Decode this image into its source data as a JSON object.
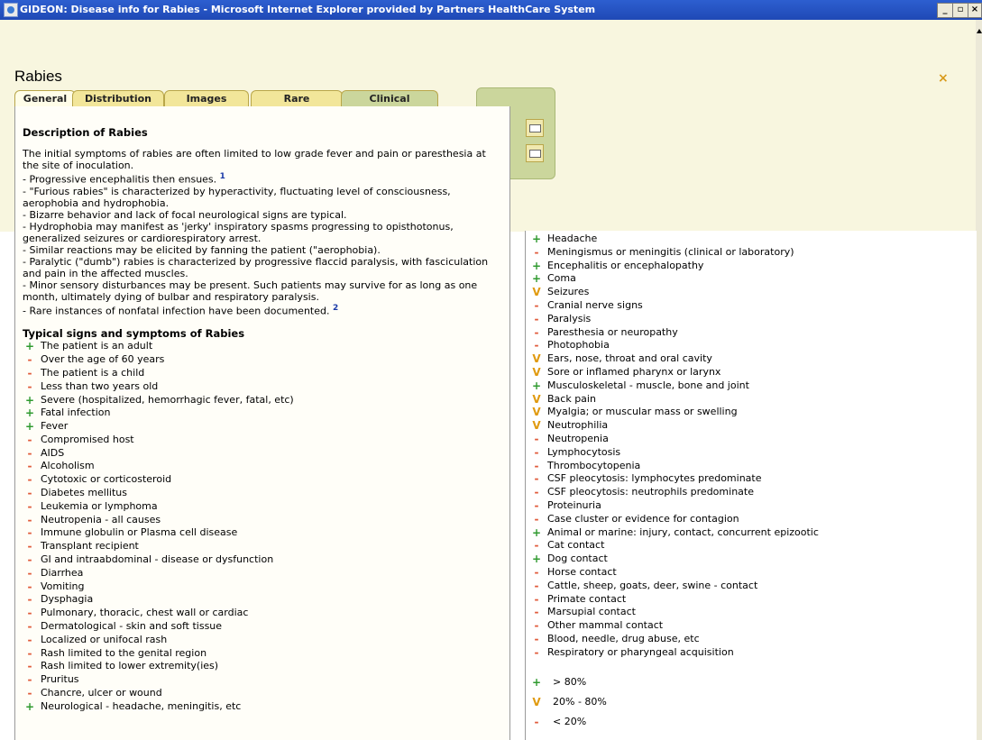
{
  "window": {
    "title": "GIDEON: Disease info for Rabies - Microsoft Internet Explorer provided by Partners HealthCare System",
    "min": "_",
    "max": "▫",
    "close": "×"
  },
  "page": {
    "title": "Rabies",
    "close_label": "×"
  },
  "tabs": [
    "General",
    "Distribution",
    "Images",
    "Rare",
    "Clinical"
  ],
  "description": {
    "heading": "Description of Rabies",
    "paragraphs": [
      "The initial symptoms of rabies are often limited to low grade fever and pain or paresthesia at the site of inoculation.",
      "- Progressive encephalitis then ensues.",
      "- \"Furious rabies\" is characterized by hyperactivity, fluctuating level of consciousness, aerophobia and hydrophobia.",
      "- Bizarre behavior and lack of focal neurological signs are typical.",
      "- Hydrophobia may manifest as 'jerky' inspiratory spasms progressing to opisthotonus, generalized seizures or cardiorespiratory arrest.",
      "- Similar reactions may be elicited by fanning the patient (\"aerophobia).",
      "- Paralytic (\"dumb\") rabies is characterized by progressive flaccid paralysis, with fasciculation and pain in the affected muscles.",
      "- Minor sensory disturbances may be present.  Such patients may survive for as long as one month, ultimately dying of bulbar and respiratory paralysis.",
      "- Rare instances of nonfatal infection have been documented."
    ],
    "footnote1": "1",
    "footnote2": "2"
  },
  "symptoms": {
    "heading": "Typical signs and symptoms of Rabies",
    "left": [
      {
        "m": "+",
        "t": "The patient is an adult"
      },
      {
        "m": "-",
        "t": "Over the age of 60 years"
      },
      {
        "m": "-",
        "t": "The patient is a child"
      },
      {
        "m": "-",
        "t": "Less than two years old"
      },
      {
        "m": "+",
        "t": "Severe (hospitalized, hemorrhagic fever, fatal, etc)"
      },
      {
        "m": "+",
        "t": "Fatal infection"
      },
      {
        "m": "+",
        "t": "Fever"
      },
      {
        "m": "-",
        "t": "Compromised host"
      },
      {
        "m": "-",
        "t": "AIDS"
      },
      {
        "m": "-",
        "t": "Alcoholism"
      },
      {
        "m": "-",
        "t": "Cytotoxic or corticosteroid"
      },
      {
        "m": "-",
        "t": "Diabetes mellitus"
      },
      {
        "m": "-",
        "t": "Leukemia or lymphoma"
      },
      {
        "m": "-",
        "t": "Neutropenia - all causes"
      },
      {
        "m": "-",
        "t": "Immune globulin or Plasma cell disease"
      },
      {
        "m": "-",
        "t": "Transplant recipient"
      },
      {
        "m": "-",
        "t": "GI and intraabdominal - disease or dysfunction"
      },
      {
        "m": "-",
        "t": "Diarrhea"
      },
      {
        "m": "-",
        "t": "Vomiting"
      },
      {
        "m": "-",
        "t": "Dysphagia"
      },
      {
        "m": "-",
        "t": "Pulmonary, thoracic, chest wall or cardiac"
      },
      {
        "m": "-",
        "t": "Dermatological - skin and soft tissue"
      },
      {
        "m": "-",
        "t": "Localized or unifocal rash"
      },
      {
        "m": "-",
        "t": "Rash limited to the genital region"
      },
      {
        "m": "-",
        "t": "Rash limited to lower extremity(ies)"
      },
      {
        "m": "-",
        "t": "Pruritus"
      },
      {
        "m": "-",
        "t": "Chancre, ulcer or wound"
      },
      {
        "m": "+",
        "t": "Neurological - headache, meningitis, etc"
      }
    ],
    "right": [
      {
        "m": "+",
        "t": "Headache"
      },
      {
        "m": "-",
        "t": "Meningismus or meningitis (clinical or laboratory)"
      },
      {
        "m": "+",
        "t": "Encephalitis or encephalopathy"
      },
      {
        "m": "+",
        "t": "Coma"
      },
      {
        "m": "V",
        "t": "Seizures"
      },
      {
        "m": "-",
        "t": "Cranial nerve signs"
      },
      {
        "m": "-",
        "t": "Paralysis"
      },
      {
        "m": "-",
        "t": "Paresthesia or neuropathy"
      },
      {
        "m": "-",
        "t": "Photophobia"
      },
      {
        "m": "V",
        "t": "Ears, nose, throat and oral cavity"
      },
      {
        "m": "V",
        "t": "Sore or inflamed pharynx or larynx"
      },
      {
        "m": "+",
        "t": "Musculoskeletal - muscle, bone and joint"
      },
      {
        "m": "V",
        "t": "Back pain"
      },
      {
        "m": "V",
        "t": "Myalgia; or muscular mass or swelling"
      },
      {
        "m": "V",
        "t": "Neutrophilia"
      },
      {
        "m": "-",
        "t": "Neutropenia"
      },
      {
        "m": "-",
        "t": "Lymphocytosis"
      },
      {
        "m": "-",
        "t": "Thrombocytopenia"
      },
      {
        "m": "-",
        "t": "CSF pleocytosis: lymphocytes predominate"
      },
      {
        "m": "-",
        "t": "CSF pleocytosis: neutrophils predominate"
      },
      {
        "m": "-",
        "t": "Proteinuria"
      },
      {
        "m": "-",
        "t": "Case cluster or evidence for contagion"
      },
      {
        "m": "+",
        "t": "Animal or marine: injury, contact, concurrent epizootic"
      },
      {
        "m": "-",
        "t": "Cat contact"
      },
      {
        "m": "+",
        "t": "Dog contact"
      },
      {
        "m": "-",
        "t": "Horse contact"
      },
      {
        "m": "-",
        "t": "Cattle, sheep, goats, deer, swine - contact"
      },
      {
        "m": "-",
        "t": "Primate contact"
      },
      {
        "m": "-",
        "t": "Marsupial contact"
      },
      {
        "m": "-",
        "t": "Other mammal contact"
      },
      {
        "m": "-",
        "t": "Blood, needle, drug abuse, etc"
      },
      {
        "m": "-",
        "t": "Respiratory or pharyngeal acquisition"
      }
    ]
  },
  "legend": [
    {
      "m": "+",
      "t": "> 80%"
    },
    {
      "m": "V",
      "t": "20% - 80%"
    },
    {
      "m": "-",
      "t": "< 20%"
    }
  ],
  "icons": {
    "print": "printer-icon",
    "mail": "mail-icon"
  },
  "colors": {
    "plus": "#2f9a2f",
    "v": "#e09a10",
    "minus": "#e05a3a"
  }
}
